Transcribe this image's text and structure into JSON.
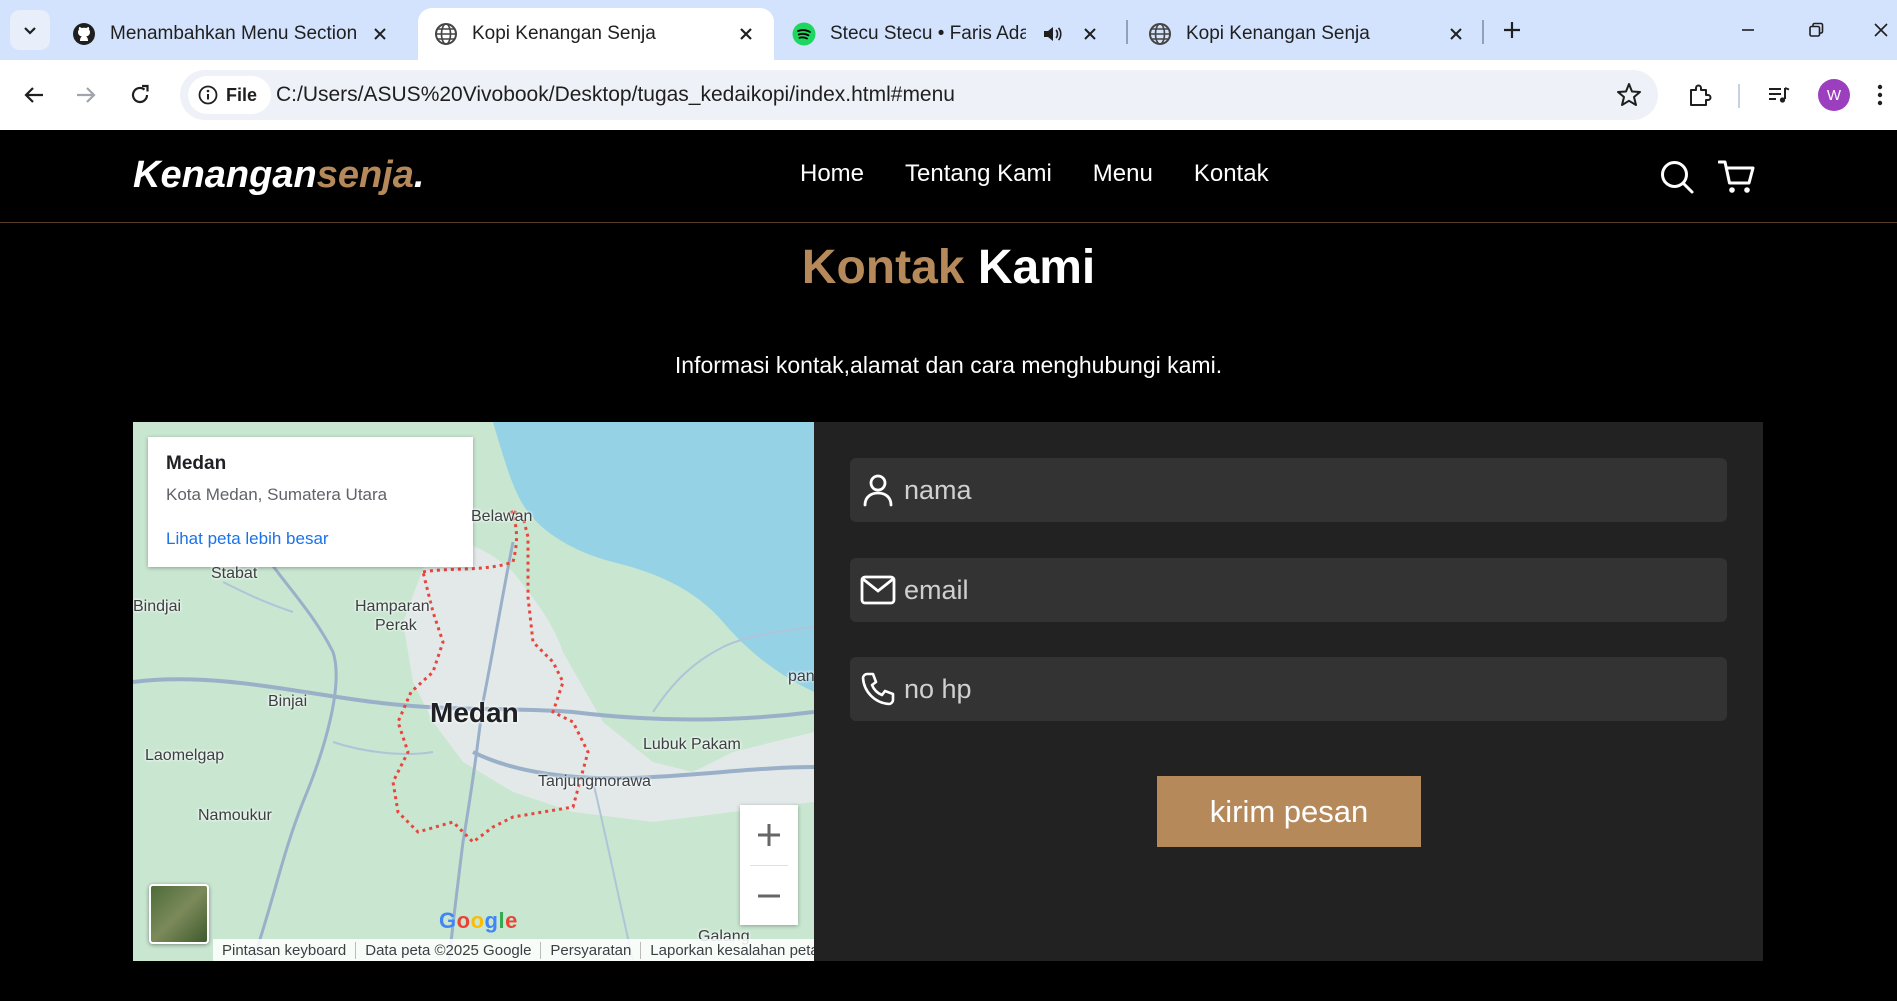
{
  "browser": {
    "tabs": [
      {
        "title": "Menambahkan Menu Section · ",
        "favicon": "github-icon",
        "active": false
      },
      {
        "title": "Kopi Kenangan Senja",
        "favicon": "globe-icon",
        "active": true
      },
      {
        "title": "Stecu Stecu • Faris Adam",
        "favicon": "spotify-icon",
        "active": false,
        "audio": true
      },
      {
        "title": "Kopi Kenangan Senja",
        "favicon": "globe-icon",
        "active": false
      }
    ],
    "chip_label": "File",
    "url": "C:/Users/ASUS%20Vivobook/Desktop/tugas_kedaikopi/index.html#menu",
    "profile_initial": "W",
    "profile_color": "#9b3fbf"
  },
  "site": {
    "logo_main": "Kenangan",
    "logo_accent": "senja",
    "logo_dot": ".",
    "accent_color": "#b6895b",
    "nav": [
      "Home",
      "Tentang Kami",
      "Menu",
      "Kontak"
    ]
  },
  "contact": {
    "title_accent": "Kontak",
    "title_main": "Kami",
    "subtitle": "Informasi kontak,alamat dan cara menghubungi kami."
  },
  "map": {
    "place": "Medan",
    "address": "Kota Medan, Sumatera Utara",
    "link": "Lihat peta lebih besar",
    "labels": {
      "belawan": "Belawan",
      "stabat": "Stabat",
      "bindjai": "Bindjai",
      "hamparan": "Hamparan",
      "perak": "Perak",
      "binjai": "Binjai",
      "medan": "Medan",
      "lubuk": "Lubuk Pakam",
      "laomelgap": "Laomelgap",
      "tanjung": "Tanjungmorawa",
      "namoukur": "Namoukur",
      "galang": "Galang",
      "pan": "pan"
    },
    "footer": [
      "Pintasan keyboard",
      "Data peta ©2025 Google",
      "Persyaratan",
      "Laporkan kesalahan peta"
    ]
  },
  "form": {
    "name_placeholder": "nama",
    "email_placeholder": "email",
    "phone_placeholder": "no hp",
    "submit_label": "kirim pesan"
  }
}
